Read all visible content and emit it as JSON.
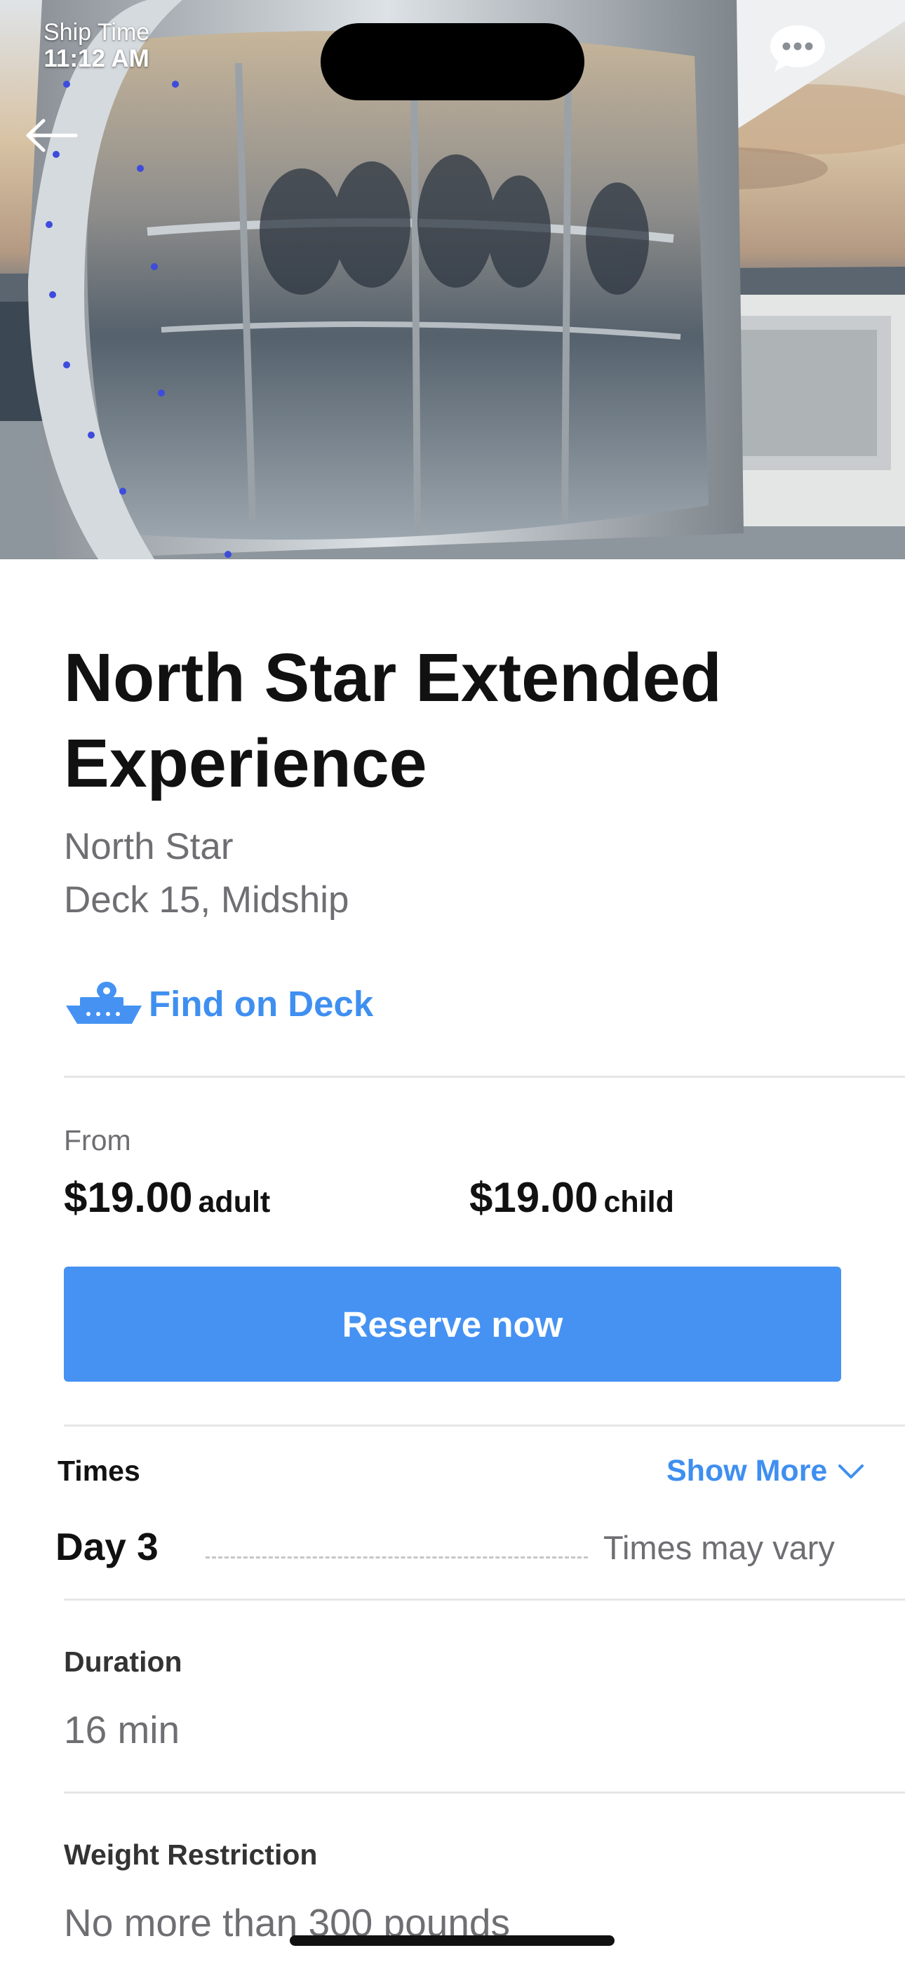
{
  "status": {
    "ship_time_label": "Ship Time",
    "ship_time_value": "11:12 AM"
  },
  "header": {
    "back_icon": "arrow-left-icon",
    "chat_icon": "chat-bubble-icon"
  },
  "activity": {
    "title": "North Star Extended Experience",
    "venue": "North Star",
    "location": "Deck 15, Midship",
    "find_on_deck": "Find on Deck"
  },
  "pricing": {
    "from_label": "From",
    "adult_price": "$19.00",
    "adult_unit": "adult",
    "child_price": "$19.00",
    "child_unit": "child"
  },
  "actions": {
    "reserve_label": "Reserve now"
  },
  "times": {
    "heading": "Times",
    "show_more": "Show More",
    "day": "Day 3",
    "note": "Times may vary"
  },
  "details": {
    "duration_label": "Duration",
    "duration_value": "16 min",
    "weight_label": "Weight Restriction",
    "weight_value": "No more than 300 pounds"
  },
  "colors": {
    "accent": "#3f8ff0",
    "button": "#4592f3"
  }
}
